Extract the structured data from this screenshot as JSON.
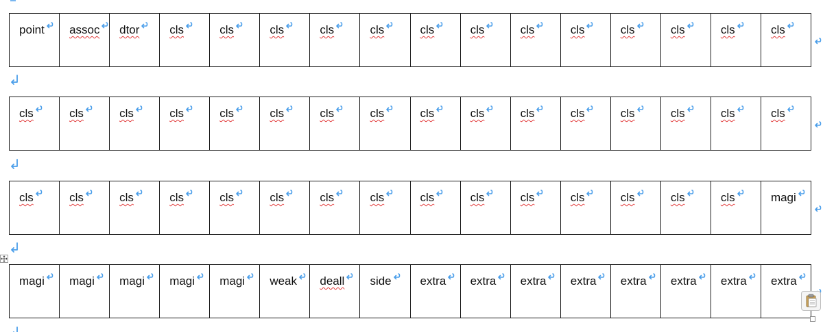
{
  "colors": {
    "mark": "#4a9eea",
    "border": "#1a1a1a",
    "spell": "#e23b3b"
  },
  "icons": {
    "cell_end": "return-arrow-icon",
    "paragraph": "paragraph-mark-icon",
    "move": "table-move-handle-icon",
    "paste": "clipboard-paste-icon"
  },
  "tables": [
    {
      "cells": [
        "point",
        "assoc",
        "dtor",
        "cls",
        "cls",
        "cls",
        "cls",
        "cls",
        "cls",
        "cls",
        "cls",
        "cls",
        "cls",
        "cls",
        "cls",
        "cls"
      ],
      "spell": [
        false,
        true,
        true,
        true,
        true,
        true,
        true,
        true,
        true,
        true,
        true,
        true,
        true,
        true,
        true,
        true
      ]
    },
    {
      "cells": [
        "cls",
        "cls",
        "cls",
        "cls",
        "cls",
        "cls",
        "cls",
        "cls",
        "cls",
        "cls",
        "cls",
        "cls",
        "cls",
        "cls",
        "cls",
        "cls"
      ],
      "spell": [
        true,
        true,
        true,
        true,
        true,
        true,
        true,
        true,
        true,
        true,
        true,
        true,
        true,
        true,
        true,
        true
      ]
    },
    {
      "cells": [
        "cls",
        "cls",
        "cls",
        "cls",
        "cls",
        "cls",
        "cls",
        "cls",
        "cls",
        "cls",
        "cls",
        "cls",
        "cls",
        "cls",
        "cls",
        "magi"
      ],
      "spell": [
        true,
        true,
        true,
        true,
        true,
        true,
        true,
        true,
        true,
        true,
        true,
        true,
        true,
        true,
        true,
        false
      ]
    },
    {
      "cells": [
        "magi",
        "magi",
        "magi",
        "magi",
        "magi",
        "weak",
        "deall",
        "side",
        "extra",
        "extra",
        "extra",
        "extra",
        "extra",
        "extra",
        "extra",
        "extra"
      ],
      "spell": [
        false,
        false,
        false,
        false,
        false,
        false,
        true,
        false,
        false,
        false,
        false,
        false,
        false,
        false,
        false,
        false
      ]
    }
  ]
}
